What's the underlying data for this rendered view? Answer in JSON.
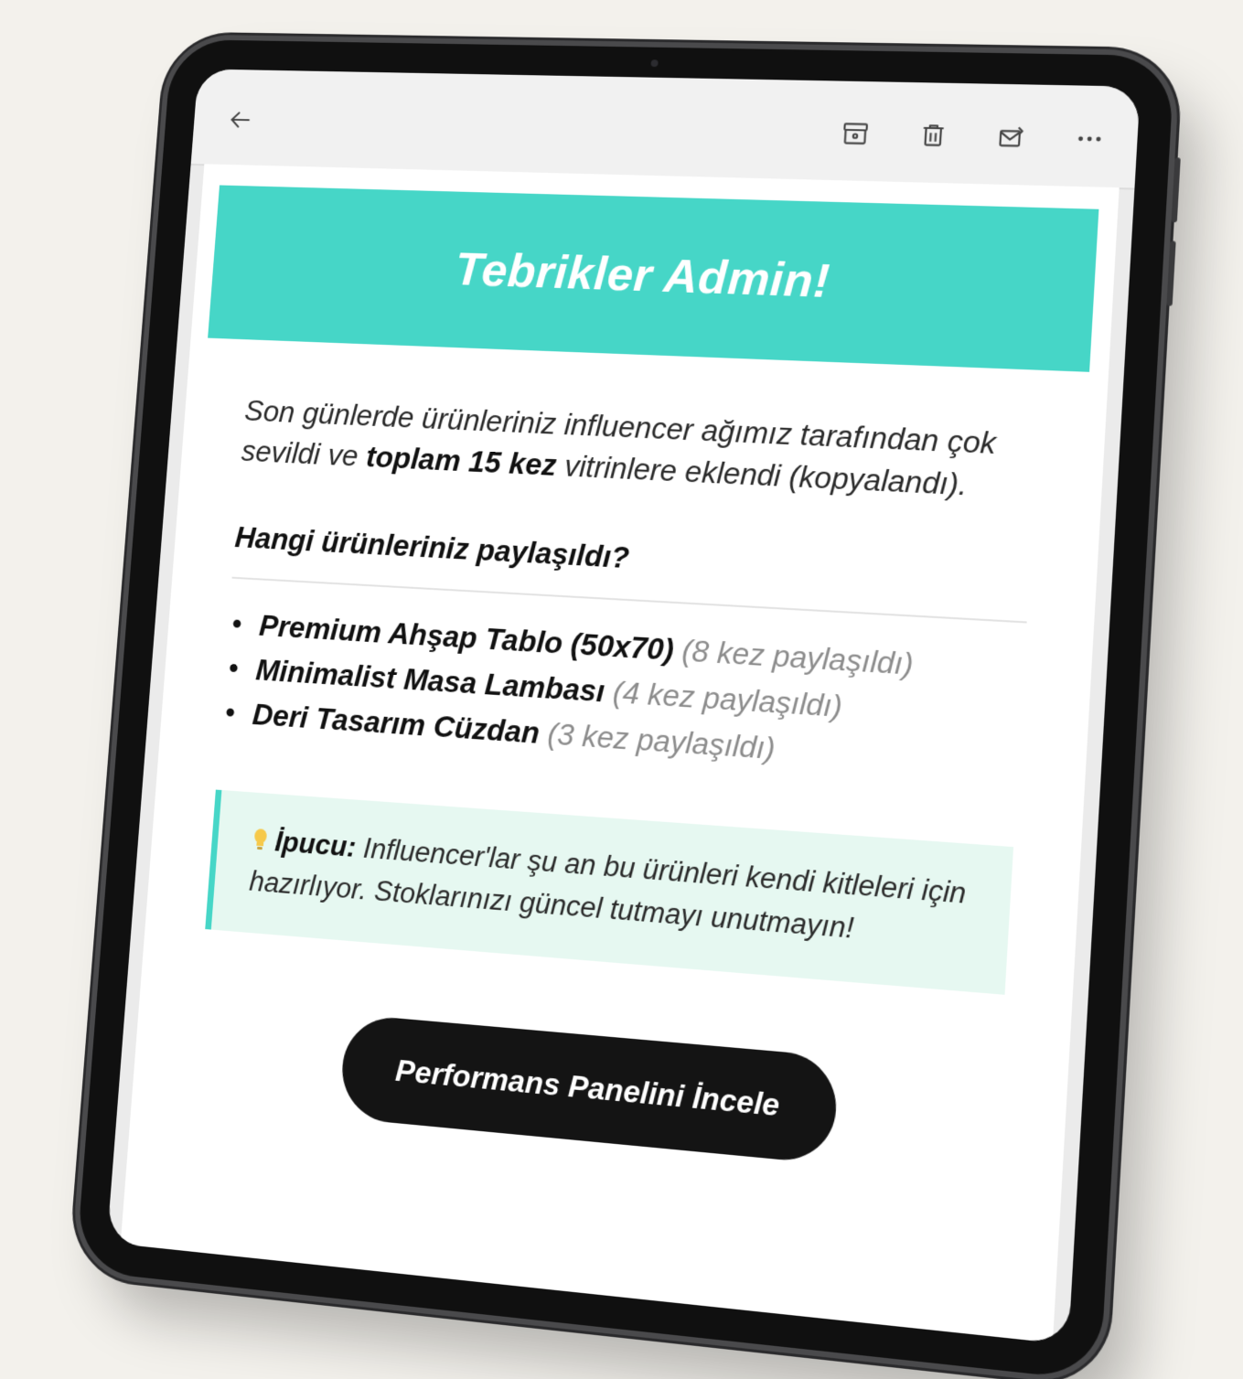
{
  "toolbar": {
    "icons": {
      "back": "arrow-left-icon",
      "archive": "archive-icon",
      "delete": "trash-icon",
      "mail": "mail-icon",
      "more": "more-horizontal-icon"
    }
  },
  "email": {
    "banner_title": "Tebrikler Admin!",
    "intro": {
      "part1": "Son günlerde ürünleriniz influencer ağımız tarafından çok sevildi ve ",
      "bold": "toplam 15 kez",
      "part2": " vitrinlere eklendi (kopyalandı)."
    },
    "section_title": "Hangi ürünleriniz paylaşıldı?",
    "products": [
      {
        "name": "Premium Ahşap Tablo (50x70)",
        "count": "(8 kez paylaşıldı)"
      },
      {
        "name": "Minimalist Masa Lambası",
        "count": "(4 kez paylaşıldı)"
      },
      {
        "name": "Deri Tasarım Cüzdan",
        "count": "(3 kez paylaşıldı)"
      }
    ],
    "tip": {
      "label": "İpucu:",
      "text": " Influencer'lar şu an bu ürünleri kendi kitleleri için hazırlıyor. Stoklarınızı güncel tutmayı unutmayın!"
    },
    "cta_label": "Performans Panelini İncele"
  },
  "colors": {
    "banner": "#46d6c7",
    "tip_background": "#e6f8f1",
    "tip_border": "#46d6c7",
    "cta_background": "#141414",
    "page_background": "#f3f1ec"
  }
}
